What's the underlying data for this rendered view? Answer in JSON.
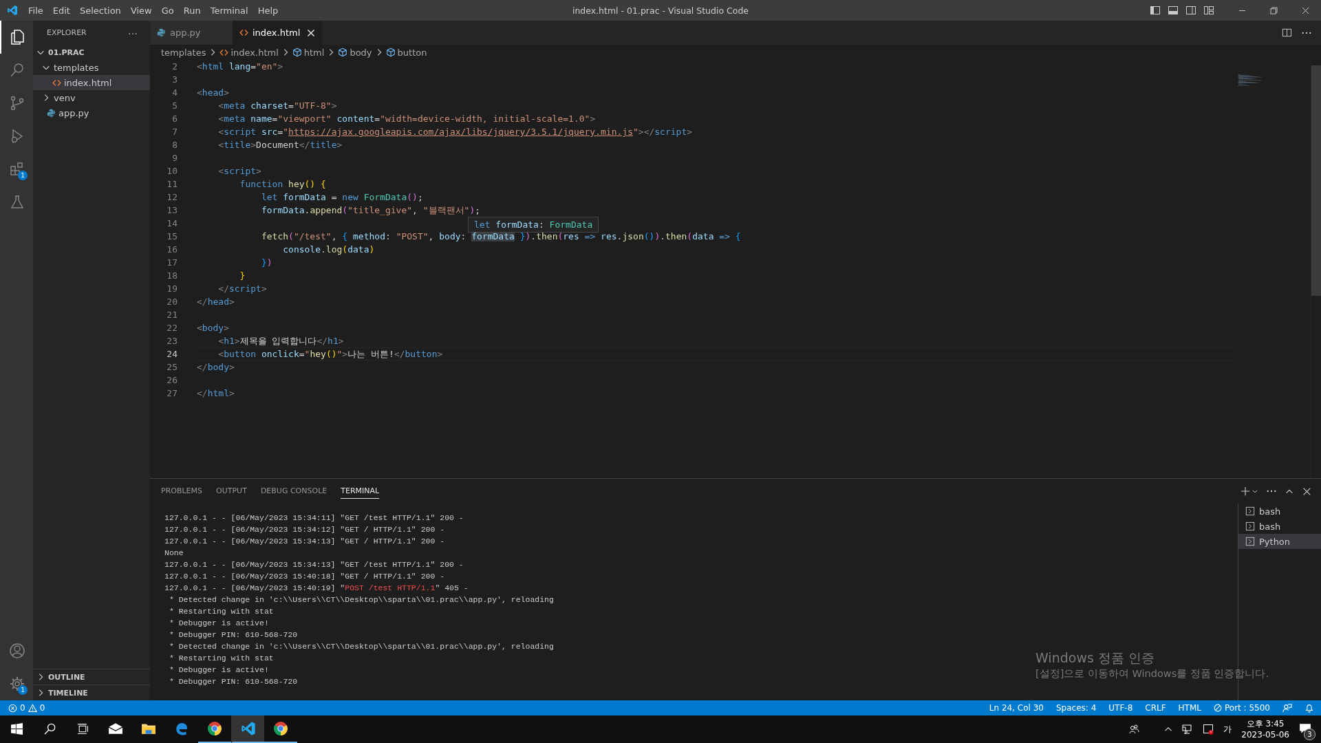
{
  "window": {
    "title": "index.html - 01.prac - Visual Studio Code",
    "menu": [
      "File",
      "Edit",
      "Selection",
      "View",
      "Go",
      "Run",
      "Terminal",
      "Help"
    ]
  },
  "activity_bar": {
    "items": [
      {
        "kind": "explorer",
        "selected": true
      },
      {
        "kind": "search",
        "selected": false
      },
      {
        "kind": "source-control",
        "selected": false
      },
      {
        "kind": "run",
        "selected": false
      },
      {
        "kind": "extensions",
        "selected": false,
        "badge": "1"
      },
      {
        "kind": "testing",
        "selected": false
      }
    ],
    "bottom": [
      {
        "kind": "account"
      },
      {
        "kind": "settings",
        "badge": "1"
      }
    ]
  },
  "sidebar": {
    "title": "EXPLORER",
    "more": "···",
    "workspace": {
      "label": "01.PRAC",
      "expanded": true,
      "children": [
        {
          "label": "templates",
          "kind": "folder",
          "expanded": true,
          "selected": false,
          "children": [
            {
              "label": "index.html",
              "kind": "html",
              "selected": true
            }
          ]
        },
        {
          "label": "venv",
          "kind": "folder",
          "expanded": false,
          "selected": false
        },
        {
          "label": "app.py",
          "kind": "python",
          "selected": false
        }
      ]
    },
    "sections": [
      {
        "label": "OUTLINE",
        "expanded": false
      },
      {
        "label": "TIMELINE",
        "expanded": false
      }
    ]
  },
  "tabs": [
    {
      "label": "app.py",
      "kind": "python",
      "selected": false
    },
    {
      "label": "index.html",
      "kind": "html",
      "selected": true
    }
  ],
  "breadcrumbs": [
    {
      "label": "templates",
      "kind": "folder"
    },
    {
      "label": "index.html",
      "kind": "html"
    },
    {
      "label": "html",
      "kind": "element"
    },
    {
      "label": "body",
      "kind": "element"
    },
    {
      "label": "button",
      "kind": "element"
    }
  ],
  "editor": {
    "lines": [
      {
        "number": "2",
        "current": false,
        "tokens": [
          {
            "kind": "p",
            "text": "<"
          },
          {
            "kind": "tag",
            "text": "html"
          },
          {
            "kind": "attr",
            "text": " lang"
          },
          {
            "kind": "txt",
            "text": "="
          },
          {
            "kind": "str",
            "text": "\"en\""
          },
          {
            "kind": "p",
            "text": ">"
          }
        ]
      },
      {
        "number": "3",
        "current": false
      },
      {
        "number": "4",
        "current": false,
        "tokens": [
          {
            "kind": "p",
            "text": "<"
          },
          {
            "kind": "tag",
            "text": "head"
          },
          {
            "kind": "p",
            "text": ">"
          }
        ]
      },
      {
        "number": "5",
        "current": false,
        "tokens": [
          {
            "kind": "p",
            "text": "    <"
          },
          {
            "kind": "tag",
            "text": "meta"
          },
          {
            "kind": "attr",
            "text": " charset"
          },
          {
            "kind": "txt",
            "text": "="
          },
          {
            "kind": "str",
            "text": "\"UTF-8\""
          },
          {
            "kind": "p",
            "text": ">"
          }
        ]
      },
      {
        "number": "6",
        "current": false,
        "tokens": [
          {
            "kind": "p",
            "text": "    <"
          },
          {
            "kind": "tag",
            "text": "meta"
          },
          {
            "kind": "attr",
            "text": " name"
          },
          {
            "kind": "txt",
            "text": "="
          },
          {
            "kind": "str",
            "text": "\"viewport\""
          },
          {
            "kind": "attr",
            "text": " content"
          },
          {
            "kind": "txt",
            "text": "="
          },
          {
            "kind": "str",
            "text": "\"width=device-width, initial-scale=1.0\""
          },
          {
            "kind": "p",
            "text": ">"
          }
        ]
      },
      {
        "number": "7",
        "current": false,
        "tokens": [
          {
            "kind": "p",
            "text": "    <"
          },
          {
            "kind": "tag",
            "text": "script"
          },
          {
            "kind": "attr",
            "text": " src"
          },
          {
            "kind": "txt",
            "text": "="
          },
          {
            "kind": "str",
            "text": "\""
          },
          {
            "kind": "url",
            "text": "https://ajax.googleapis.com/ajax/libs/jquery/3.5.1/jquery.min.js"
          },
          {
            "kind": "str",
            "text": "\""
          },
          {
            "kind": "p",
            "text": "></"
          },
          {
            "kind": "tag",
            "text": "script"
          },
          {
            "kind": "p",
            "text": ">"
          }
        ]
      },
      {
        "number": "8",
        "current": false,
        "tokens": [
          {
            "kind": "p",
            "text": "    <"
          },
          {
            "kind": "tag",
            "text": "title"
          },
          {
            "kind": "p",
            "text": ">"
          },
          {
            "kind": "txt",
            "text": "Document"
          },
          {
            "kind": "p",
            "text": "</"
          },
          {
            "kind": "tag",
            "text": "title"
          },
          {
            "kind": "p",
            "text": ">"
          }
        ]
      },
      {
        "number": "9",
        "current": false
      },
      {
        "number": "10",
        "current": false,
        "tokens": [
          {
            "kind": "p",
            "text": "    <"
          },
          {
            "kind": "tag",
            "text": "script"
          },
          {
            "kind": "p",
            "text": ">"
          }
        ]
      },
      {
        "number": "11",
        "current": false,
        "tokens": [
          {
            "kind": "kw",
            "text": "        function"
          },
          {
            "kind": "fn",
            "text": " hey"
          },
          {
            "kind": "b1",
            "text": "()"
          },
          {
            "kind": "b1",
            "text": " {"
          }
        ]
      },
      {
        "number": "12",
        "current": false,
        "tokens": [
          {
            "kind": "kw",
            "text": "            let"
          },
          {
            "kind": "var",
            "text": " formData"
          },
          {
            "kind": "txt",
            "text": " = "
          },
          {
            "kind": "kw",
            "text": "new"
          },
          {
            "kind": "cls",
            "text": " FormData"
          },
          {
            "kind": "b2",
            "text": "()"
          },
          {
            "kind": "txt",
            "text": ";"
          }
        ]
      },
      {
        "number": "13",
        "current": false,
        "tokens": [
          {
            "kind": "var",
            "text": "            formData"
          },
          {
            "kind": "txt",
            "text": "."
          },
          {
            "kind": "fn",
            "text": "append"
          },
          {
            "kind": "b2",
            "text": "("
          },
          {
            "kind": "str",
            "text": "\"title_give\""
          },
          {
            "kind": "txt",
            "text": ", "
          },
          {
            "kind": "str",
            "text": "\"블랙팬서\""
          },
          {
            "kind": "b2",
            "text": ")"
          },
          {
            "kind": "txt",
            "text": ";"
          }
        ]
      },
      {
        "number": "14",
        "current": false
      },
      {
        "number": "15",
        "current": false,
        "tokens": [
          {
            "kind": "fn",
            "text": "            fetch"
          },
          {
            "kind": "b2",
            "text": "("
          },
          {
            "kind": "str",
            "text": "\"/test\""
          },
          {
            "kind": "txt",
            "text": ", "
          },
          {
            "kind": "b3",
            "text": "{"
          },
          {
            "kind": "var",
            "text": " method"
          },
          {
            "kind": "txt",
            "text": ": "
          },
          {
            "kind": "str",
            "text": "\"POST\""
          },
          {
            "kind": "txt",
            "text": ", "
          },
          {
            "kind": "var",
            "text": "body"
          },
          {
            "kind": "txt",
            "text": ": "
          },
          {
            "kind": "hl",
            "text": "formData"
          },
          {
            "kind": "b3",
            "text": " }"
          },
          {
            "kind": "b2",
            "text": ")"
          },
          {
            "kind": "txt",
            "text": "."
          },
          {
            "kind": "fn",
            "text": "then"
          },
          {
            "kind": "b2",
            "text": "("
          },
          {
            "kind": "var",
            "text": "res"
          },
          {
            "kind": "kw",
            "text": " =>"
          },
          {
            "kind": "var",
            "text": " res"
          },
          {
            "kind": "txt",
            "text": "."
          },
          {
            "kind": "fn",
            "text": "json"
          },
          {
            "kind": "b3",
            "text": "()"
          },
          {
            "kind": "b2",
            "text": ")"
          },
          {
            "kind": "txt",
            "text": "."
          },
          {
            "kind": "fn",
            "text": "then"
          },
          {
            "kind": "b2",
            "text": "("
          },
          {
            "kind": "var",
            "text": "data"
          },
          {
            "kind": "kw",
            "text": " =>"
          },
          {
            "kind": "b3",
            "text": " {"
          }
        ]
      },
      {
        "number": "16",
        "current": false,
        "tokens": [
          {
            "kind": "var",
            "text": "                console"
          },
          {
            "kind": "txt",
            "text": "."
          },
          {
            "kind": "fn",
            "text": "log"
          },
          {
            "kind": "b1",
            "text": "("
          },
          {
            "kind": "var",
            "text": "data"
          },
          {
            "kind": "b1",
            "text": ")"
          }
        ]
      },
      {
        "number": "17",
        "current": false,
        "tokens": [
          {
            "kind": "b3",
            "text": "            }"
          },
          {
            "kind": "b2",
            "text": ")"
          }
        ]
      },
      {
        "number": "18",
        "current": false,
        "tokens": [
          {
            "kind": "b1",
            "text": "        }"
          }
        ]
      },
      {
        "number": "19",
        "current": false,
        "tokens": [
          {
            "kind": "p",
            "text": "    </"
          },
          {
            "kind": "tag",
            "text": "script"
          },
          {
            "kind": "p",
            "text": ">"
          }
        ]
      },
      {
        "number": "20",
        "current": false,
        "tokens": [
          {
            "kind": "p",
            "text": "</"
          },
          {
            "kind": "tag",
            "text": "head"
          },
          {
            "kind": "p",
            "text": ">"
          }
        ]
      },
      {
        "number": "21",
        "current": false
      },
      {
        "number": "22",
        "current": false,
        "tokens": [
          {
            "kind": "p",
            "text": "<"
          },
          {
            "kind": "tag",
            "text": "body"
          },
          {
            "kind": "p",
            "text": ">"
          }
        ]
      },
      {
        "number": "23",
        "current": false,
        "tokens": [
          {
            "kind": "p",
            "text": "    <"
          },
          {
            "kind": "tag",
            "text": "h1"
          },
          {
            "kind": "p",
            "text": ">"
          },
          {
            "kind": "txt",
            "text": "제목을 입력합니다"
          },
          {
            "kind": "p",
            "text": "</"
          },
          {
            "kind": "tag",
            "text": "h1"
          },
          {
            "kind": "p",
            "text": ">"
          }
        ]
      },
      {
        "number": "24",
        "current": true,
        "tokens": [
          {
            "kind": "p",
            "text": "    <"
          },
          {
            "kind": "tag",
            "text": "button"
          },
          {
            "kind": "attr",
            "text": " onclick"
          },
          {
            "kind": "txt",
            "text": "="
          },
          {
            "kind": "str",
            "text": "\""
          },
          {
            "kind": "fn",
            "text": "hey"
          },
          {
            "kind": "b1",
            "text": "()"
          },
          {
            "kind": "str",
            "text": "\""
          },
          {
            "kind": "p",
            "text": ">"
          },
          {
            "kind": "txt",
            "text": "나는 버튼!"
          },
          {
            "kind": "p",
            "text": "</"
          },
          {
            "kind": "tag",
            "text": "button"
          },
          {
            "kind": "p",
            "text": ">"
          }
        ]
      },
      {
        "number": "25",
        "current": false,
        "tokens": [
          {
            "kind": "p",
            "text": "</"
          },
          {
            "kind": "tag",
            "text": "body"
          },
          {
            "kind": "p",
            "text": ">"
          }
        ]
      },
      {
        "number": "26",
        "current": false
      },
      {
        "number": "27",
        "current": false,
        "tokens": [
          {
            "kind": "p",
            "text": "</"
          },
          {
            "kind": "tag",
            "text": "html"
          },
          {
            "kind": "p",
            "text": ">"
          }
        ]
      }
    ],
    "hover": {
      "tokens": [
        {
          "kind": "kw",
          "text": "let"
        },
        {
          "kind": "var",
          "text": " formData"
        },
        {
          "kind": "txt",
          "text": ": "
        },
        {
          "kind": "cls",
          "text": "FormData"
        }
      ]
    }
  },
  "panel": {
    "tabs": [
      {
        "label": "PROBLEMS",
        "selected": false
      },
      {
        "label": "OUTPUT",
        "selected": false
      },
      {
        "label": "DEBUG CONSOLE",
        "selected": false
      },
      {
        "label": "TERMINAL",
        "selected": true
      }
    ],
    "terminal_lines": [
      {
        "segments": [
          {
            "kind": "plain",
            "text": "127.0.0.1 - - [06/May/2023 15:34:11] \"GET /test HTTP/1.1\" 200 -"
          }
        ]
      },
      {
        "segments": [
          {
            "kind": "plain",
            "text": "127.0.0.1 - - [06/May/2023 15:34:12] \"GET / HTTP/1.1\" 200 -"
          }
        ]
      },
      {
        "segments": [
          {
            "kind": "plain",
            "text": "127.0.0.1 - - [06/May/2023 15:34:13] \"GET / HTTP/1.1\" 200 -"
          }
        ]
      },
      {
        "segments": [
          {
            "kind": "plain",
            "text": "None"
          }
        ]
      },
      {
        "segments": [
          {
            "kind": "plain",
            "text": "127.0.0.1 - - [06/May/2023 15:34:13] \"GET /test HTTP/1.1\" 200 -"
          }
        ]
      },
      {
        "segments": [
          {
            "kind": "plain",
            "text": "127.0.0.1 - - [06/May/2023 15:40:18] \"GET / HTTP/1.1\" 200 -"
          }
        ]
      },
      {
        "segments": [
          {
            "kind": "plain",
            "text": "127.0.0.1 - - [06/May/2023 15:40:19] \""
          },
          {
            "kind": "error",
            "text": "POST /test HTTP/1.1"
          },
          {
            "kind": "plain",
            "text": "\" 405 -"
          }
        ]
      },
      {
        "segments": [
          {
            "kind": "plain",
            "text": " * Detected change in 'c:\\\\Users\\\\CT\\\\Desktop\\\\sparta\\\\01.prac\\\\app.py', reloading"
          }
        ]
      },
      {
        "segments": [
          {
            "kind": "plain",
            "text": " * Restarting with stat"
          }
        ]
      },
      {
        "segments": [
          {
            "kind": "plain",
            "text": " * Debugger is active!"
          }
        ]
      },
      {
        "segments": [
          {
            "kind": "plain",
            "text": " * Debugger PIN: 610-568-720"
          }
        ]
      },
      {
        "segments": [
          {
            "kind": "plain",
            "text": " * Detected change in 'c:\\\\Users\\\\CT\\\\Desktop\\\\sparta\\\\01.prac\\\\app.py', reloading"
          }
        ]
      },
      {
        "segments": [
          {
            "kind": "plain",
            "text": " * Restarting with stat"
          }
        ]
      },
      {
        "segments": [
          {
            "kind": "plain",
            "text": " * Debugger is active!"
          }
        ]
      },
      {
        "segments": [
          {
            "kind": "plain",
            "text": " * Debugger PIN: 610-568-720"
          }
        ]
      }
    ],
    "terminals": [
      {
        "label": "bash",
        "selected": false
      },
      {
        "label": "bash",
        "selected": false
      },
      {
        "label": "Python",
        "selected": true
      }
    ]
  },
  "status_bar": {
    "errors": "0",
    "warnings": "0",
    "items": [
      {
        "kind": "text",
        "text": "Ln 24, Col 30"
      },
      {
        "kind": "text",
        "text": "Spaces: 4"
      },
      {
        "kind": "text",
        "text": "UTF-8"
      },
      {
        "kind": "text",
        "text": "CRLF"
      },
      {
        "kind": "text",
        "text": "HTML"
      },
      {
        "kind": "port",
        "text": "Port : 5500"
      }
    ]
  },
  "activation_notice": {
    "title": "Windows 정품 인증",
    "message": "[설정]으로 이동하여 Windows를 정품 인증합니다."
  },
  "taskbar": {
    "buttons": [
      {
        "kind": "start",
        "running": false,
        "active": false
      },
      {
        "kind": "search",
        "running": false,
        "active": false
      },
      {
        "kind": "task-view",
        "running": false,
        "active": false
      },
      {
        "kind": "mail",
        "running": false,
        "active": false
      },
      {
        "kind": "folder",
        "running": false,
        "active": false
      },
      {
        "kind": "edge",
        "running": false,
        "active": false
      },
      {
        "kind": "chrome",
        "running": true,
        "active": false
      },
      {
        "kind": "vscode",
        "running": true,
        "active": true
      },
      {
        "kind": "chrome",
        "running": true,
        "active": false
      }
    ],
    "ime": "가",
    "time": "오후 3:45",
    "date": "2023-05-06",
    "notifications": "3"
  }
}
